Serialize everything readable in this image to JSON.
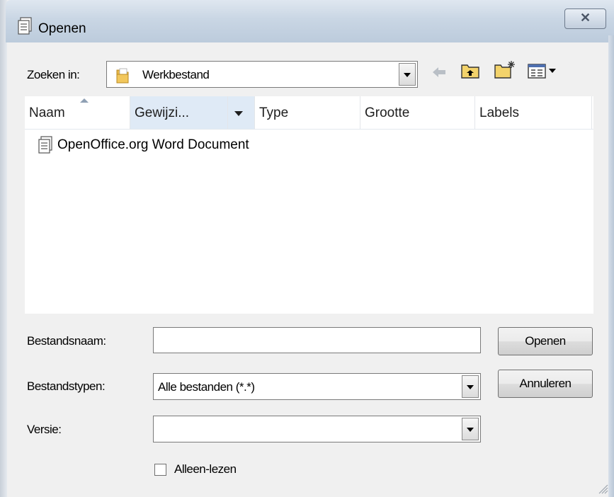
{
  "window": {
    "title": "Openen",
    "close_label": "✕"
  },
  "toolbar": {
    "look_in_label": "Zoeken in:",
    "look_in_value": "Werkbestand",
    "icons": [
      "back-arrow-icon",
      "up-folder-icon",
      "new-folder-icon",
      "view-menu-icon"
    ]
  },
  "filelist": {
    "columns": [
      "Naam",
      "Gewijzi...",
      "Type",
      "Grootte",
      "Labels"
    ],
    "sorted_column": "Naam",
    "items": [
      {
        "name": "OpenOffice.org Word Document",
        "icon": "document-icon"
      }
    ]
  },
  "form": {
    "filename_label": "Bestandsnaam:",
    "filename_value": "",
    "filetype_label": "Bestandstypen:",
    "filetype_value": "Alle bestanden (*.*)",
    "version_label": "Versie:",
    "version_value": "",
    "readonly_label": "Alleen-lezen",
    "readonly_checked": false
  },
  "buttons": {
    "open": "Openen",
    "cancel": "Annuleren"
  },
  "colors": {
    "title_gradient_top": "#dfe7f0",
    "title_gradient_bottom": "#bccbdc",
    "header_active": "#dfeaf6",
    "background": "#f0f0f0"
  }
}
